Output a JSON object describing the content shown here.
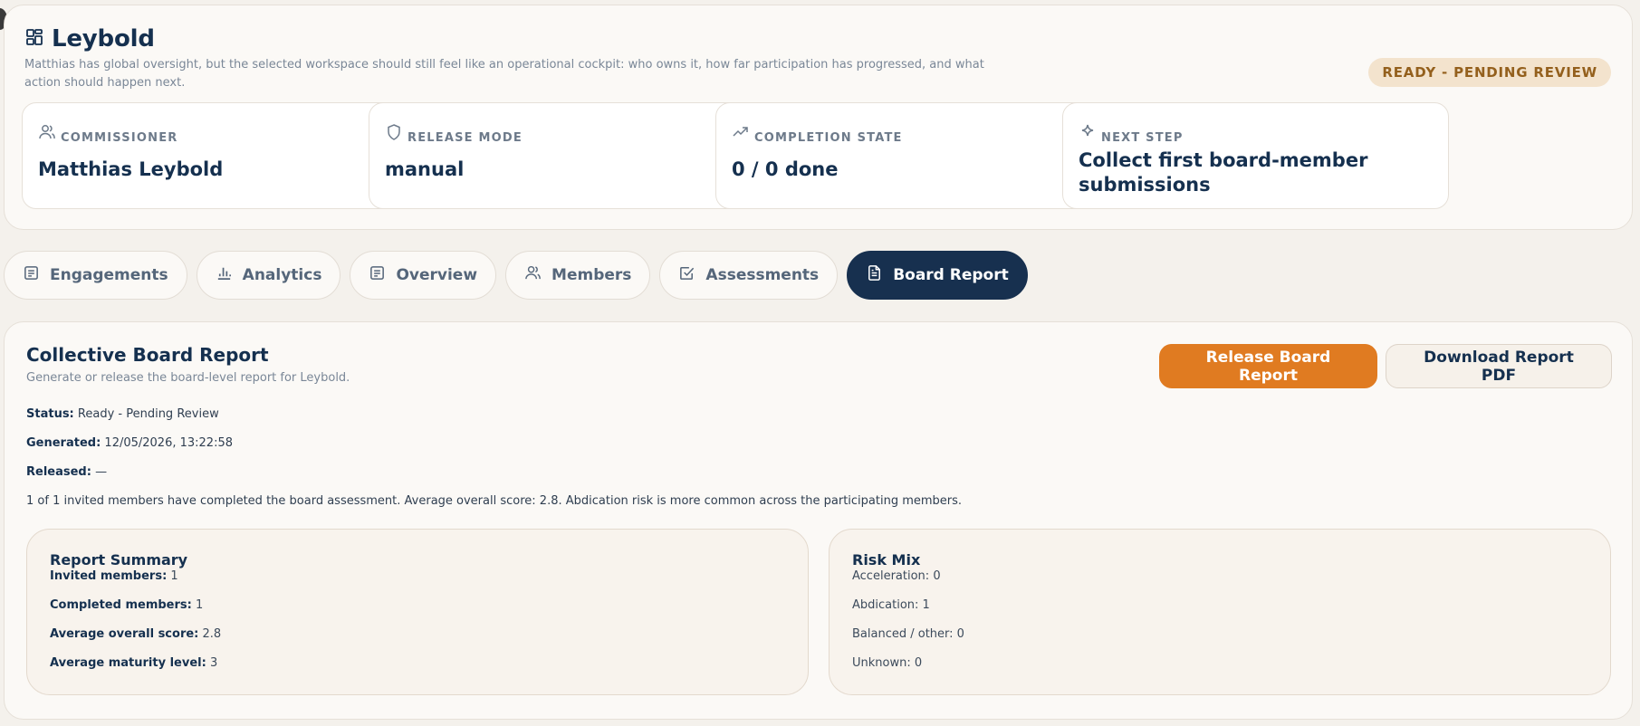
{
  "workspace": {
    "title": "Leybold",
    "description": "Matthias has global oversight, but the selected workspace should still feel like an operational cockpit: who owns it, how far participation has progressed, and what action should happen next.",
    "status_badge": "READY - PENDING REVIEW"
  },
  "stats": [
    {
      "label": "COMMISSIONER",
      "icon": "users-icon",
      "value": "Matthias Leybold"
    },
    {
      "label": "RELEASE MODE",
      "icon": "shield-icon",
      "value": "manual"
    },
    {
      "label": "COMPLETION STATE",
      "icon": "trending-up-icon",
      "value": "0 / 0 done"
    },
    {
      "label": "NEXT STEP",
      "icon": "sparkle-icon",
      "value": "Collect first board-member submissions"
    }
  ],
  "tabs": [
    {
      "label": "Engagements",
      "icon": "list-icon",
      "active": false
    },
    {
      "label": "Analytics",
      "icon": "bar-chart-icon",
      "active": false
    },
    {
      "label": "Overview",
      "icon": "list-icon",
      "active": false
    },
    {
      "label": "Members",
      "icon": "users-icon",
      "active": false
    },
    {
      "label": "Assessments",
      "icon": "check-square-icon",
      "active": false
    },
    {
      "label": "Board Report",
      "icon": "file-text-icon",
      "active": true
    }
  ],
  "report": {
    "title": "Collective Board Report",
    "subtitle": "Generate or release the board-level report for Leybold.",
    "release_button": "Release Board Report",
    "download_button": "Download Report PDF",
    "status_label": "Status:",
    "status_value": "Ready - Pending Review",
    "generated_label": "Generated:",
    "generated_value": "12/05/2026, 13:22:58",
    "released_label": "Released:",
    "released_value": "—",
    "summary_text": "1 of 1 invited members have completed the board assessment. Average overall score: 2.8. Abdication risk is more common across the participating members."
  },
  "summary_panel": {
    "title": "Report Summary",
    "rows": [
      {
        "label": "Invited members:",
        "value": "1"
      },
      {
        "label": "Completed members:",
        "value": "1"
      },
      {
        "label": "Average overall score:",
        "value": "2.8"
      },
      {
        "label": "Average maturity level:",
        "value": "3"
      }
    ]
  },
  "risk_panel": {
    "title": "Risk Mix",
    "rows": [
      {
        "label": "Acceleration:",
        "value": "0"
      },
      {
        "label": "Abdication:",
        "value": "1"
      },
      {
        "label": "Balanced / other:",
        "value": "0"
      },
      {
        "label": "Unknown:",
        "value": "0"
      }
    ]
  },
  "colors": {
    "navy": "#15304f",
    "accent_orange": "#e07b21",
    "badge_bg": "#f3e3cd",
    "badge_text": "#94601d",
    "page_bg": "#f4f1ec"
  }
}
